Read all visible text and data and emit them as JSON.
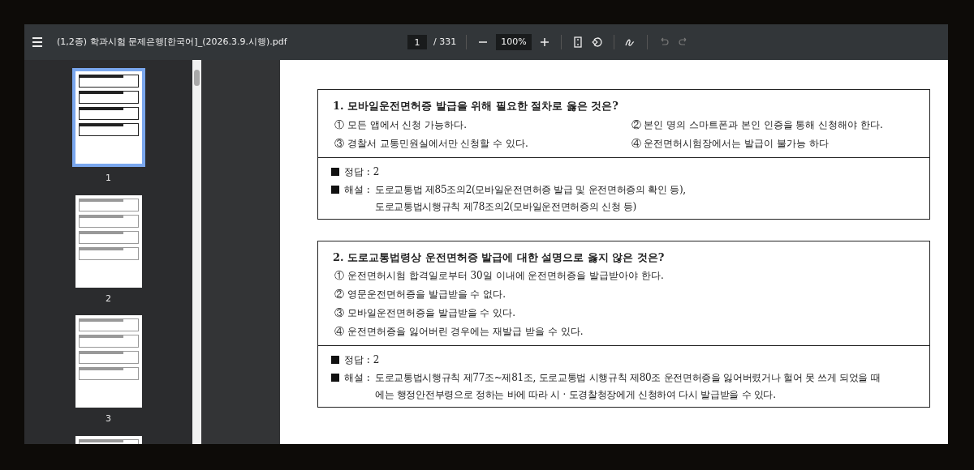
{
  "toolbar": {
    "title": "(1,2종) 학과시험 문제은행[한국어]_(2026.3.9.시행).pdf",
    "page_input": "1",
    "page_total": "/ 331",
    "zoom": "100%"
  },
  "thumbnails": [
    {
      "label": "1",
      "selected": true
    },
    {
      "label": "2",
      "selected": false
    },
    {
      "label": "3",
      "selected": false
    },
    {
      "selected": false
    }
  ],
  "questions": [
    {
      "title": "1. 모바일운전면허증 발급을 위해 필요한 절차로 옳은 것은?",
      "kind": "two-column",
      "options": [
        "① 모든 앱에서 신청 가능하다.",
        "② 본인 명의 스마트폰과 본인 인증을 통해 신청해야 한다.",
        "③ 경찰서 교통민원실에서만 신청할 수 있다.",
        "④ 운전면허시험장에서는 발급이 불가능 하다"
      ],
      "answer": "정답 : 2",
      "explanation_label": "해설 :",
      "explanation": [
        "도로교통법 제85조의2(모바일운전면허증 발급 및 운전면허증의 확인 등),",
        "도로교통법시행규칙 제78조의2(모바일운전면허증의 신청 등)"
      ]
    },
    {
      "title": "2. 도로교통법령상 운전면허증 발급에 대한 설명으로 옳지 않은 것은?",
      "kind": "one-column",
      "options": [
        "① 운전면허시험 합격일로부터 30일 이내에 운전면허증을 발급받아야 한다.",
        "② 영문운전면허증을 발급받을 수 없다.",
        "③ 모바일운전면허증을 발급받을 수 있다.",
        "④ 운전면허증을 잃어버린 경우에는 재발급 받을 수 있다."
      ],
      "answer": "정답 : 2",
      "explanation_label": "해설 :",
      "explanation": [
        "도로교통법시행규칙 제77조~제81조, 도로교통법 시행규칙 제80조 운전면허증을 잃어버렸거나 헐어 못 쓰게 되었을 때",
        "에는 행정안전부령으로 정하는 바에 따라 시 · 도경찰청장에게 신청하여 다시 발급받을 수 있다."
      ]
    }
  ]
}
